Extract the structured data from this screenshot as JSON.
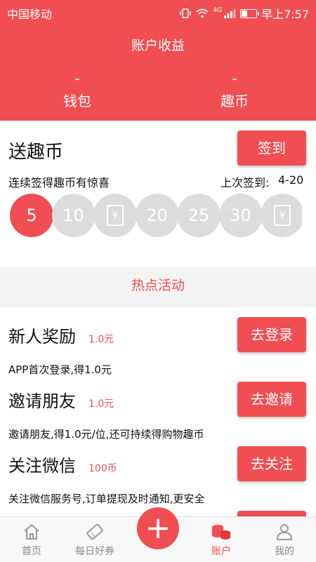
{
  "status_bar": {
    "carrier": "中国移动",
    "time": "早上7:57",
    "network": "4G"
  },
  "header": {
    "title": "账户收益",
    "wallet": {
      "value": "-",
      "label": "钱包"
    },
    "coins": {
      "value": "-",
      "label": "趣币"
    }
  },
  "sign_in": {
    "title": "送趣币",
    "button": "签到",
    "subtitle": "连续签得趣币有惊喜",
    "last_label": "上次签到:",
    "last_date": "4-20",
    "days": [
      {
        "label": "5",
        "active": true,
        "icon": null
      },
      {
        "label": "10",
        "active": false,
        "icon": null
      },
      {
        "label": "",
        "active": false,
        "icon": "ticket-icon",
        "glyph": "¥"
      },
      {
        "label": "20",
        "active": false,
        "icon": null
      },
      {
        "label": "25",
        "active": false,
        "icon": null
      },
      {
        "label": "30",
        "active": false,
        "icon": null
      },
      {
        "label": "",
        "active": false,
        "icon": "ticket-icon",
        "glyph": "¥"
      }
    ]
  },
  "hot_title": "热点活动",
  "activities": [
    {
      "title": "新人奖励",
      "reward": "1.0元",
      "desc": "APP首次登录,得1.0元",
      "button": "去登录"
    },
    {
      "title": "邀请朋友",
      "reward": "1.0元",
      "desc": "邀请朋友,得1.0元/位,还可持续得购物趣币",
      "button": "去邀请"
    },
    {
      "title": "关注微信",
      "reward": "100币",
      "desc": "关注微信服务号,订单提现及时通知,更安全",
      "button": "去关注"
    }
  ],
  "tabs": {
    "home": "首页",
    "coupons": "每日好券",
    "plus": "+",
    "account": "账户",
    "mine": "我的"
  },
  "colors": {
    "accent": "#f04e52",
    "inactive_circle": "#dcdcdc"
  }
}
